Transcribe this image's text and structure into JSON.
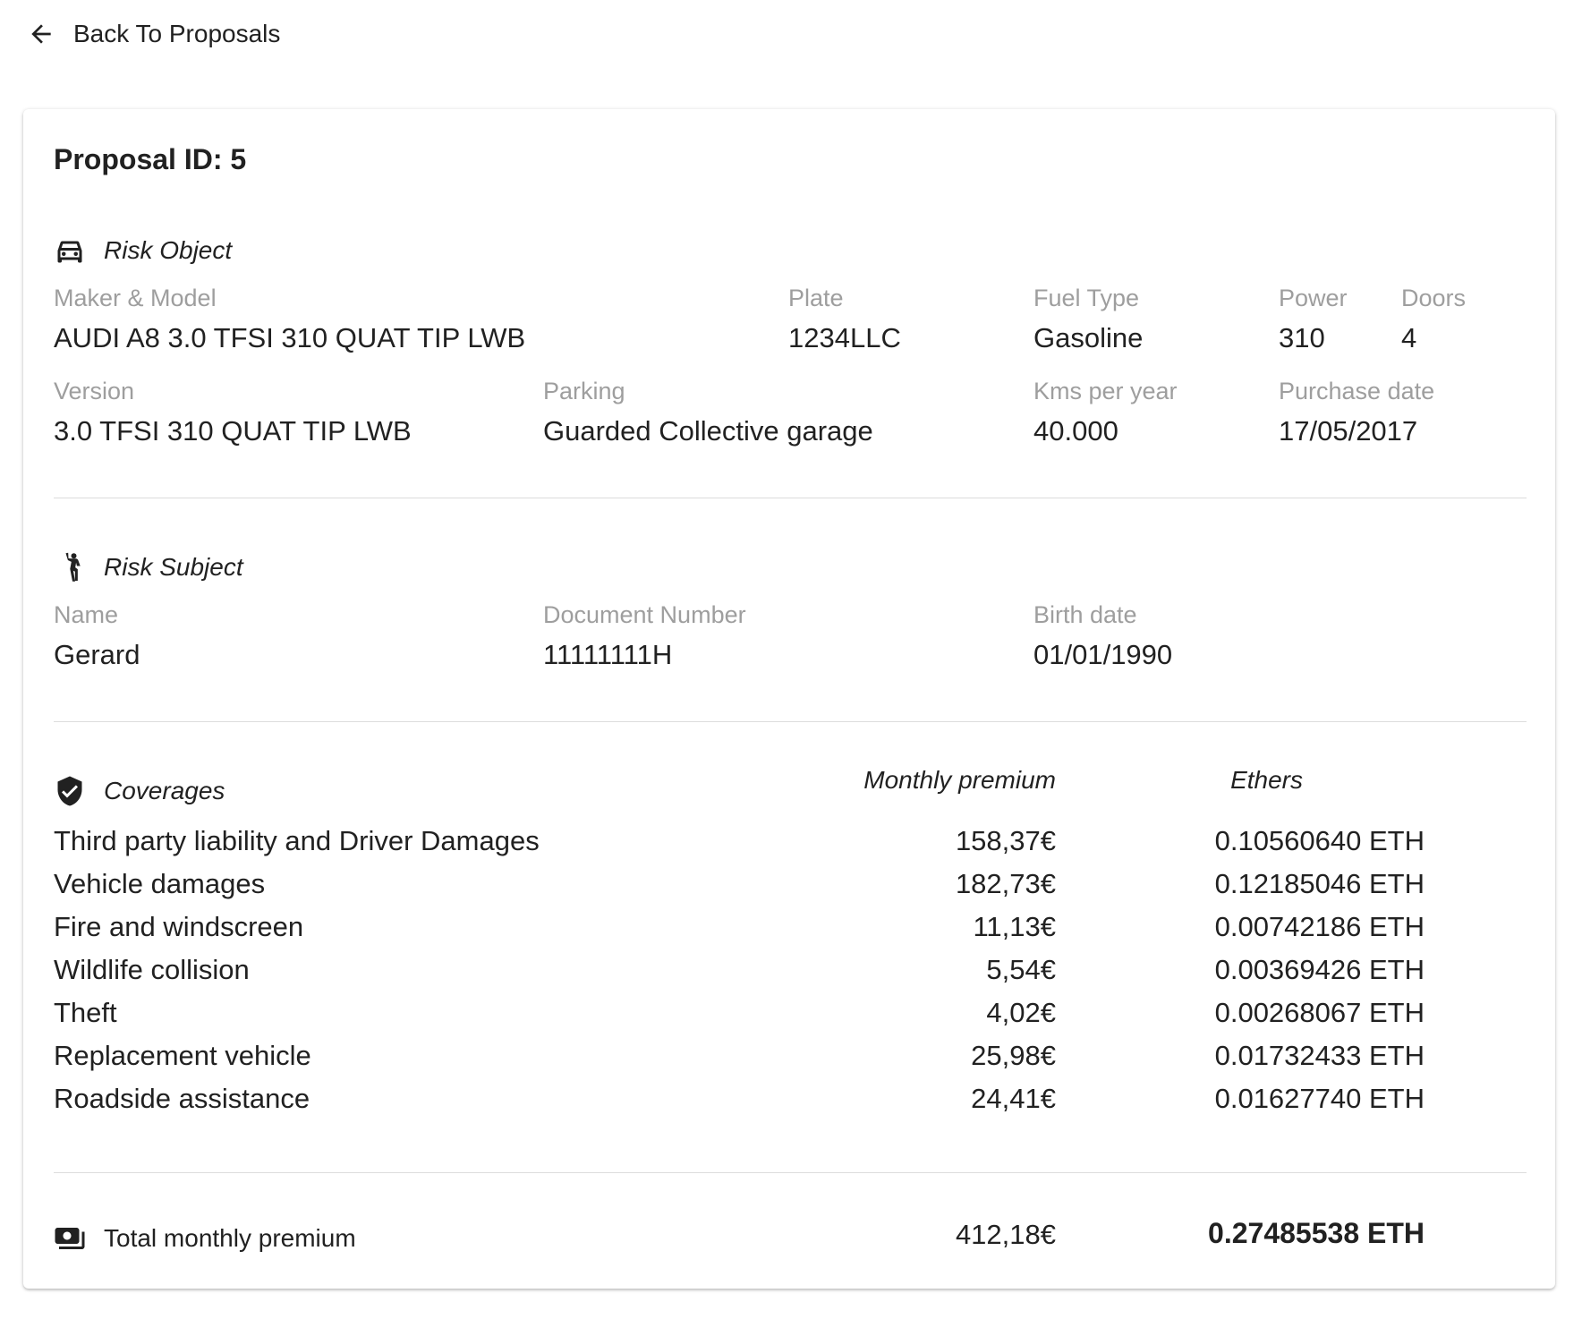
{
  "nav": {
    "back_label": "Back To Proposals"
  },
  "proposal": {
    "title": "Proposal ID: 5"
  },
  "risk_object": {
    "heading": "Risk Object",
    "icon": "car-icon",
    "fields": {
      "maker_model": {
        "label": "Maker & Model",
        "value": "AUDI A8 3.0 TFSI 310 QUAT TIP LWB"
      },
      "plate": {
        "label": "Plate",
        "value": "1234LLC"
      },
      "fuel_type": {
        "label": "Fuel Type",
        "value": "Gasoline"
      },
      "power": {
        "label": "Power",
        "value": "310"
      },
      "doors": {
        "label": "Doors",
        "value": "4"
      },
      "version": {
        "label": "Version",
        "value": "3.0 TFSI 310 QUAT TIP LWB"
      },
      "parking": {
        "label": "Parking",
        "value": "Guarded Collective garage"
      },
      "kms_per_year": {
        "label": "Kms per year",
        "value": "40.000"
      },
      "purchase_date": {
        "label": "Purchase date",
        "value": "17/05/2017"
      }
    }
  },
  "risk_subject": {
    "heading": "Risk Subject",
    "icon": "person-waving-icon",
    "fields": {
      "name": {
        "label": "Name",
        "value": "Gerard"
      },
      "document_number": {
        "label": "Document Number",
        "value": "11111111H"
      },
      "birth_date": {
        "label": "Birth date",
        "value": "01/01/1990"
      }
    }
  },
  "coverages": {
    "heading": "Coverages",
    "icon": "shield-check-icon",
    "col_premium": "Monthly premium",
    "col_ethers": "Ethers",
    "rows": [
      {
        "name": "Third party liability and Driver Damages",
        "premium": "158,37€",
        "eth": "0.10560640 ETH"
      },
      {
        "name": "Vehicle damages",
        "premium": "182,73€",
        "eth": "0.12185046 ETH"
      },
      {
        "name": "Fire and windscreen",
        "premium": "11,13€",
        "eth": "0.00742186 ETH"
      },
      {
        "name": "Wildlife collision",
        "premium": "5,54€",
        "eth": "0.00369426 ETH"
      },
      {
        "name": "Theft",
        "premium": "4,02€",
        "eth": "0.00268067 ETH"
      },
      {
        "name": "Replacement vehicle",
        "premium": "25,98€",
        "eth": "0.01732433 ETH"
      },
      {
        "name": "Roadside assistance",
        "premium": "24,41€",
        "eth": "0.01627740 ETH"
      }
    ]
  },
  "total": {
    "icon": "money-icon",
    "label": "Total monthly premium",
    "premium": "412,18€",
    "eth": "0.27485538 ETH"
  }
}
